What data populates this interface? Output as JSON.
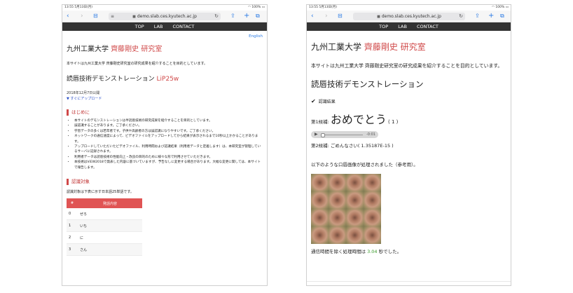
{
  "status": {
    "time": "13:55",
    "date": "5月13日(月)",
    "battery": "100%"
  },
  "browser": {
    "url": "demo.slab.ces.kyutech.ac.jp"
  },
  "nav": {
    "items": [
      "TOP",
      "LAB",
      "CONTACT"
    ]
  },
  "left_page": {
    "english_link": "English",
    "site_title_main": "九州工業大学",
    "site_title_lab": "齊藤剛史 研究室",
    "intro": "本サイトは九州工業大学 齊藤剛史研究室の研究成果を紹介することを目的としています。",
    "demo_title": "読唇技術デモンストレーション",
    "demo_version": "LiP25w",
    "date": "2018年12月7日公開",
    "jump_link": "▼ すぐにアップロード",
    "section1": "はじめに",
    "notes": [
      "本サイトのデモンストレーションは半読唇技術の研究成果を紹介することを目的としています。",
      "誤認識することがあります。ご了承ください。",
      "学習データの多くは若年者です。子供や高齢者の方は誤認識になりやすいです。ご了承ください。",
      "ネットワークの通信速度によって、ビデオファイルをアップロードしてから結果が表示されるまで10秒以上かかることがあります。",
      "アップロードしていただいたビデオファイル、利用時間および認識結果（利用者データと定義します）は、本研究室が管理しているサーバに記録されます。",
      "利用者データは読唇技術の性能向上・改良の目的のために様々な形で利用させていただきます。",
      "本技術はViEW2018で発表した内容に基づいていますが、予告なしに変更する場合があります。大幅な変更に関しては、本サイトで報告します。"
    ],
    "section2": "認識対象",
    "section2_text": "認識対象は下表に示す日本語25単語です。",
    "table_headers": [
      "#",
      "発話内容"
    ],
    "table_rows": [
      [
        "0",
        "ぜろ"
      ],
      [
        "1",
        "いち"
      ],
      [
        "2",
        "に"
      ],
      [
        "3",
        "さん"
      ]
    ]
  },
  "right_page": {
    "site_title_main": "九州工業大学",
    "site_title_lab": "齊藤剛史 研究室",
    "intro": "本サイトは九州工業大学 齊藤剛史研究室の研究成果を紹介することを目的としています。",
    "demo_title": "読唇技術デモンストレーション",
    "result_label": "認識結果",
    "cand1_label": "第1候補:",
    "cand1_word": "おめでとう",
    "cand1_score": "( 1 )",
    "audio_time": "-0:01",
    "cand2_label": "第2候補:",
    "cand2_text": "ごめんなさい( 1.35187E-15 )",
    "processed_text": "以下のような口唇画像が処理されました（参考用）。",
    "time_prefix": "通信時間を除く処理時間は",
    "time_value": "3.04",
    "time_suffix": "秒でした。"
  }
}
